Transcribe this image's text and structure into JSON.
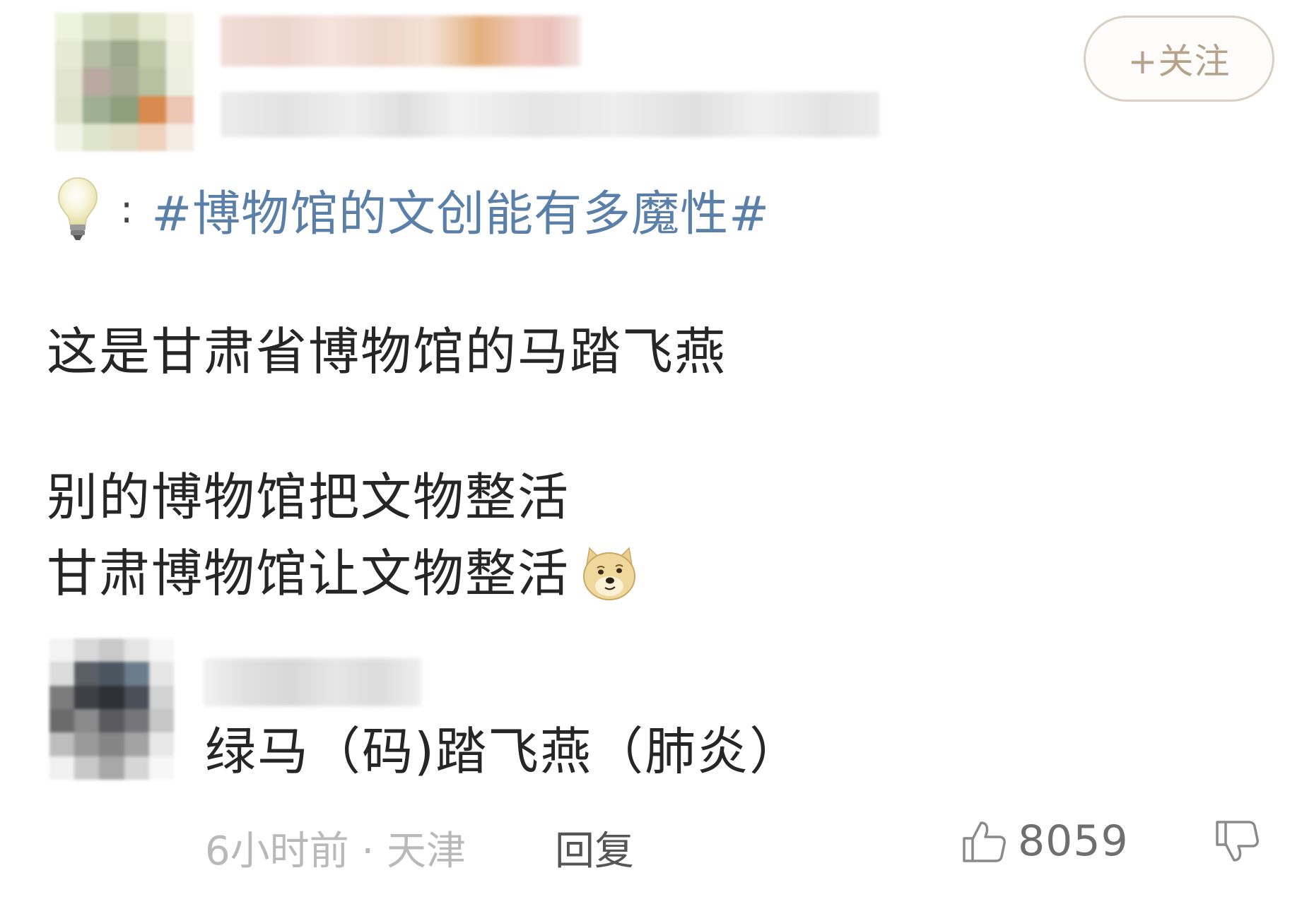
{
  "header": {
    "follow_label": "+关注"
  },
  "post": {
    "topic_separator": ":",
    "topic_tag": "#博物馆的文创能有多魔性#",
    "lines": [
      "这是甘肃省博物馆的马踏飞燕",
      "别的博物馆把文物整活",
      "甘肃博物馆让文物整活"
    ]
  },
  "comment": {
    "text": "绿马（码)踏飞燕（肺炎）",
    "time_location": "6小时前 · 天津",
    "reply_label": "回复",
    "like_count": "8059"
  },
  "icons": {
    "topic": "lightbulb-icon",
    "emoji": "doge-emoji-icon",
    "like": "thumb-up-icon",
    "dislike": "thumb-down-icon"
  },
  "colors": {
    "topic_link": "#5a7fa8",
    "follow_text": "#b6a289",
    "follow_border": "#d9cfc2",
    "meta_text": "#b9b9b9"
  }
}
